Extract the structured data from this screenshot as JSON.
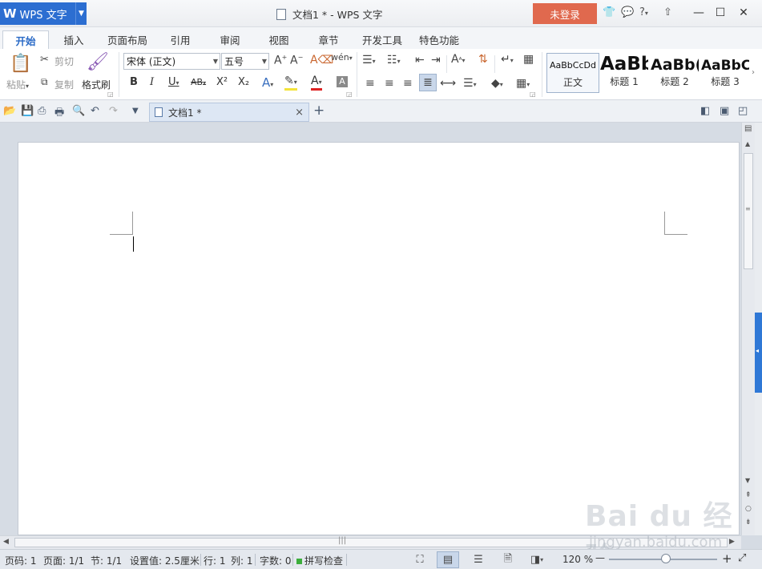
{
  "titlebar": {
    "app_name": "WPS 文字",
    "app_icon": "W",
    "doc_title": "文档1 * - WPS 文字",
    "login_label": "未登录",
    "icons": [
      "skin-icon",
      "chat-icon",
      "help-icon",
      "upload-icon"
    ],
    "help_glyph": "?",
    "minimize": "—",
    "maximize": "☐",
    "close": "✕"
  },
  "menu": {
    "tabs": [
      "开始",
      "插入",
      "页面布局",
      "引用",
      "审阅",
      "视图",
      "章节",
      "开发工具",
      "特色功能"
    ],
    "active": "开始"
  },
  "ribbon": {
    "paste_label": "粘贴",
    "cut_label": "剪切",
    "copy_label": "复制",
    "format_painter_label": "格式刷",
    "font_name": "宋体 (正文)",
    "font_size": "五号",
    "bold": "B",
    "italic": "I",
    "underline": "U",
    "strike": "AB",
    "superscript": "X²",
    "subscript": "X₂",
    "font_color": "A",
    "styles": [
      {
        "sample": "AaBbCcDd",
        "name": "正文"
      },
      {
        "sample": "AaBb",
        "name": "标题 1"
      },
      {
        "sample": "AaBb(",
        "name": "标题 2"
      },
      {
        "sample": "AaBbC",
        "name": "标题 3"
      }
    ]
  },
  "doc_tab": {
    "label": "文档1 *",
    "close": "×",
    "add": "+"
  },
  "status": {
    "page_code": "页码: 1",
    "page": "页面: 1/1",
    "section": "节: 1/1",
    "setting": "设置值: 2.5厘米",
    "row": "行: 1",
    "col": "列: 1",
    "word_count": "字数: 0",
    "spell_check": "拼写检查",
    "zoom": "120 %",
    "zoom_minus": "—",
    "zoom_plus": "+"
  },
  "watermark": {
    "main": "Bai du 经验",
    "sub": "jingyan.baidu.com"
  },
  "colors": {
    "app_blue": "#2c6ed1",
    "login_orange": "#e0694e",
    "page_bg": "#ffffff",
    "workspace_bg": "#d6dce4",
    "scroll_tab_blue": "#2f78d6"
  }
}
